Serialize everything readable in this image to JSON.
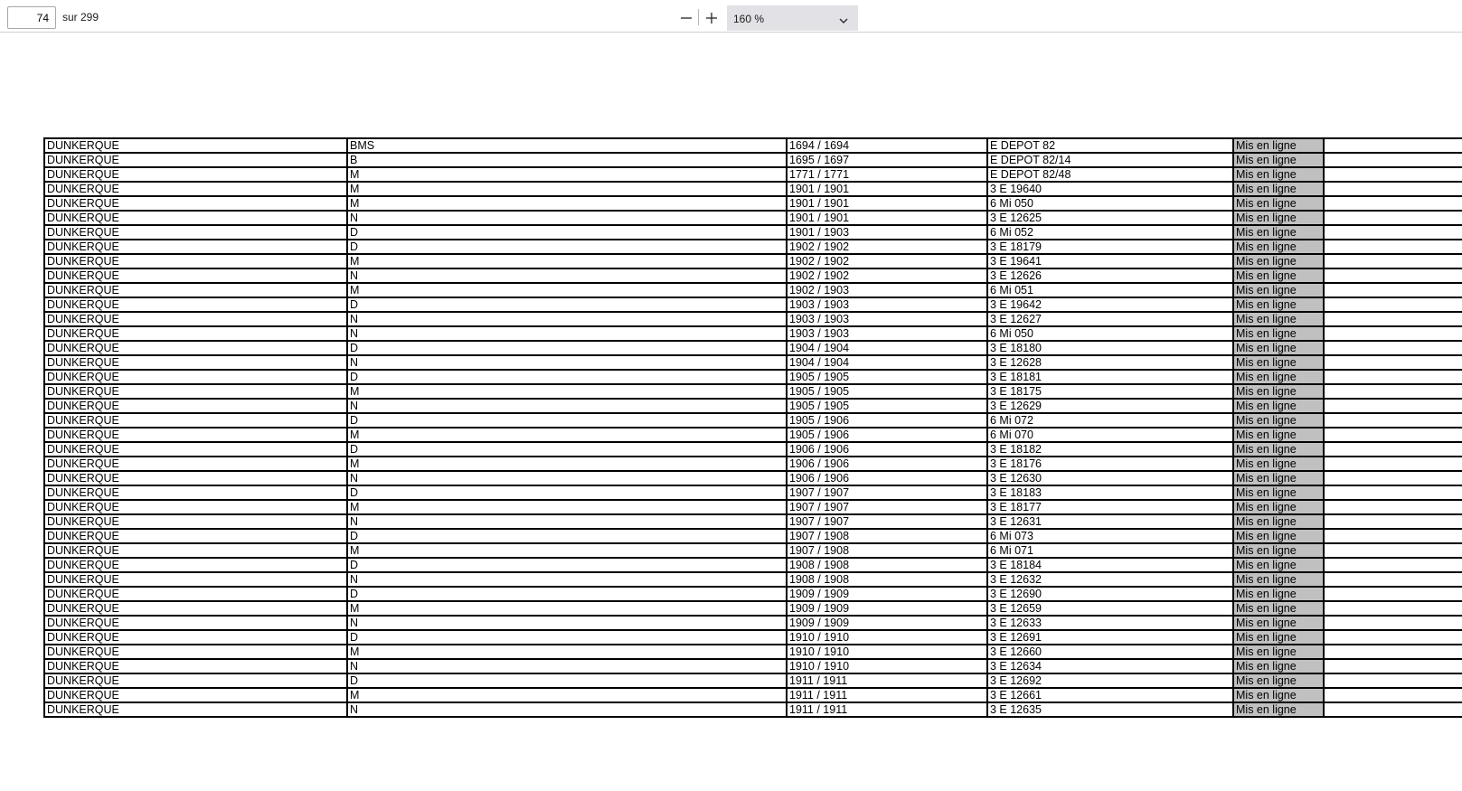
{
  "toolbar": {
    "page_number": "74",
    "page_total": "sur 299",
    "zoom_level": "160 %",
    "zoom_out_icon": "minus-icon",
    "zoom_in_icon": "plus-icon",
    "dropdown_icon": "chevron-down-icon"
  },
  "colors": {
    "status_cell_bg": "#c0c0c0",
    "zoom_select_bg": "#e1e1e6"
  },
  "table": {
    "rows": [
      [
        "DUNKERQUE",
        "BMS",
        "1694 / 1694",
        "E DEPOT 82",
        "Mis en ligne",
        ""
      ],
      [
        "DUNKERQUE",
        "B",
        "1695 / 1697",
        "E DEPOT 82/14",
        "Mis en ligne",
        ""
      ],
      [
        "DUNKERQUE",
        "M",
        "1771 / 1771",
        "E DEPOT 82/48",
        "Mis en ligne",
        ""
      ],
      [
        "DUNKERQUE",
        "M",
        "1901 / 1901",
        "3 E 19640",
        "Mis en ligne",
        ""
      ],
      [
        "DUNKERQUE",
        "M",
        "1901 / 1901",
        "6 Mi 050",
        "Mis en ligne",
        ""
      ],
      [
        "DUNKERQUE",
        "N",
        "1901 / 1901",
        "3 E 12625",
        "Mis en ligne",
        ""
      ],
      [
        "DUNKERQUE",
        "D",
        "1901 / 1903",
        "6 Mi 052",
        "Mis en ligne",
        ""
      ],
      [
        "DUNKERQUE",
        "D",
        "1902 / 1902",
        "3 E 18179",
        "Mis en ligne",
        ""
      ],
      [
        "DUNKERQUE",
        "M",
        "1902 / 1902",
        "3 E 19641",
        "Mis en ligne",
        ""
      ],
      [
        "DUNKERQUE",
        "N",
        "1902 / 1902",
        "3 E 12626",
        "Mis en ligne",
        ""
      ],
      [
        "DUNKERQUE",
        "M",
        "1902 / 1903",
        "6 Mi 051",
        "Mis en ligne",
        ""
      ],
      [
        "DUNKERQUE",
        "D",
        "1903 / 1903",
        "3 E 19642",
        "Mis en ligne",
        ""
      ],
      [
        "DUNKERQUE",
        "N",
        "1903 / 1903",
        "3 E 12627",
        "Mis en ligne",
        ""
      ],
      [
        "DUNKERQUE",
        "N",
        "1903 / 1903",
        "6 Mi 050",
        "Mis en ligne",
        ""
      ],
      [
        "DUNKERQUE",
        "D",
        "1904 / 1904",
        "3 E 18180",
        "Mis en ligne",
        ""
      ],
      [
        "DUNKERQUE",
        "N",
        "1904 / 1904",
        "3 E 12628",
        "Mis en ligne",
        ""
      ],
      [
        "DUNKERQUE",
        "D",
        "1905 / 1905",
        "3 E 18181",
        "Mis en ligne",
        ""
      ],
      [
        "DUNKERQUE",
        "M",
        "1905 / 1905",
        "3 E 18175",
        "Mis en ligne",
        ""
      ],
      [
        "DUNKERQUE",
        "N",
        "1905 / 1905",
        "3 E 12629",
        "Mis en ligne",
        ""
      ],
      [
        "DUNKERQUE",
        "D",
        "1905 / 1906",
        "6 Mi 072",
        "Mis en ligne",
        ""
      ],
      [
        "DUNKERQUE",
        "M",
        "1905 / 1906",
        "6 Mi 070",
        "Mis en ligne",
        ""
      ],
      [
        "DUNKERQUE",
        "D",
        "1906 / 1906",
        "3 E 18182",
        "Mis en ligne",
        ""
      ],
      [
        "DUNKERQUE",
        "M",
        "1906 / 1906",
        "3 E 18176",
        "Mis en ligne",
        ""
      ],
      [
        "DUNKERQUE",
        "N",
        "1906 / 1906",
        "3 E 12630",
        "Mis en ligne",
        ""
      ],
      [
        "DUNKERQUE",
        "D",
        "1907 / 1907",
        "3 E 18183",
        "Mis en ligne",
        ""
      ],
      [
        "DUNKERQUE",
        "M",
        "1907 / 1907",
        "3 E 18177",
        "Mis en ligne",
        ""
      ],
      [
        "DUNKERQUE",
        "N",
        "1907 / 1907",
        "3 E 12631",
        "Mis en ligne",
        ""
      ],
      [
        "DUNKERQUE",
        "D",
        "1907 / 1908",
        "6 Mi 073",
        "Mis en ligne",
        ""
      ],
      [
        "DUNKERQUE",
        "M",
        "1907 / 1908",
        "6 Mi 071",
        "Mis en ligne",
        ""
      ],
      [
        "DUNKERQUE",
        "D",
        "1908 / 1908",
        "3 E 18184",
        "Mis en ligne",
        ""
      ],
      [
        "DUNKERQUE",
        "N",
        "1908 / 1908",
        "3 E 12632",
        "Mis en ligne",
        ""
      ],
      [
        "DUNKERQUE",
        "D",
        "1909 / 1909",
        "3 E 12690",
        "Mis en ligne",
        ""
      ],
      [
        "DUNKERQUE",
        "M",
        "1909 / 1909",
        "3 E 12659",
        "Mis en ligne",
        ""
      ],
      [
        "DUNKERQUE",
        "N",
        "1909 / 1909",
        "3 E 12633",
        "Mis en ligne",
        ""
      ],
      [
        "DUNKERQUE",
        "D",
        "1910 / 1910",
        "3 E 12691",
        "Mis en ligne",
        ""
      ],
      [
        "DUNKERQUE",
        "M",
        "1910 / 1910",
        "3 E 12660",
        "Mis en ligne",
        ""
      ],
      [
        "DUNKERQUE",
        "N",
        "1910 / 1910",
        "3 E 12634",
        "Mis en ligne",
        ""
      ],
      [
        "DUNKERQUE",
        "D",
        "1911 / 1911",
        "3 E 12692",
        "Mis en ligne",
        ""
      ],
      [
        "DUNKERQUE",
        "M",
        "1911 / 1911",
        "3 E 12661",
        "Mis en ligne",
        ""
      ],
      [
        "DUNKERQUE",
        "N",
        "1911 / 1911",
        "3 E 12635",
        "Mis en ligne",
        ""
      ]
    ]
  }
}
